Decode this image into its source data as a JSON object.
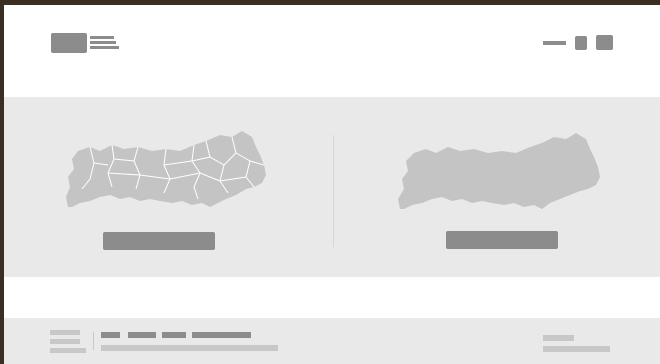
{
  "colors": {
    "outer_border": "#3a2f22",
    "placeholder_dark": "#8c8c8c",
    "placeholder_light": "#c8c8c8",
    "band_bg": "#e9e9e9",
    "map_fill": "#c4c4c4",
    "page_bg": "#ffffff"
  },
  "header": {
    "logo_icon": "logo-icon",
    "nav": [
      "menu-line-icon",
      "nav-square-icon",
      "nav-square-icon"
    ]
  },
  "main": {
    "options": [
      {
        "map": "algarve-municipalities-map",
        "button_label": ""
      },
      {
        "map": "algarve-region-map",
        "button_label": ""
      }
    ]
  },
  "footer": {
    "links": [
      "",
      "",
      "",
      ""
    ],
    "right_text": [
      "",
      ""
    ]
  }
}
